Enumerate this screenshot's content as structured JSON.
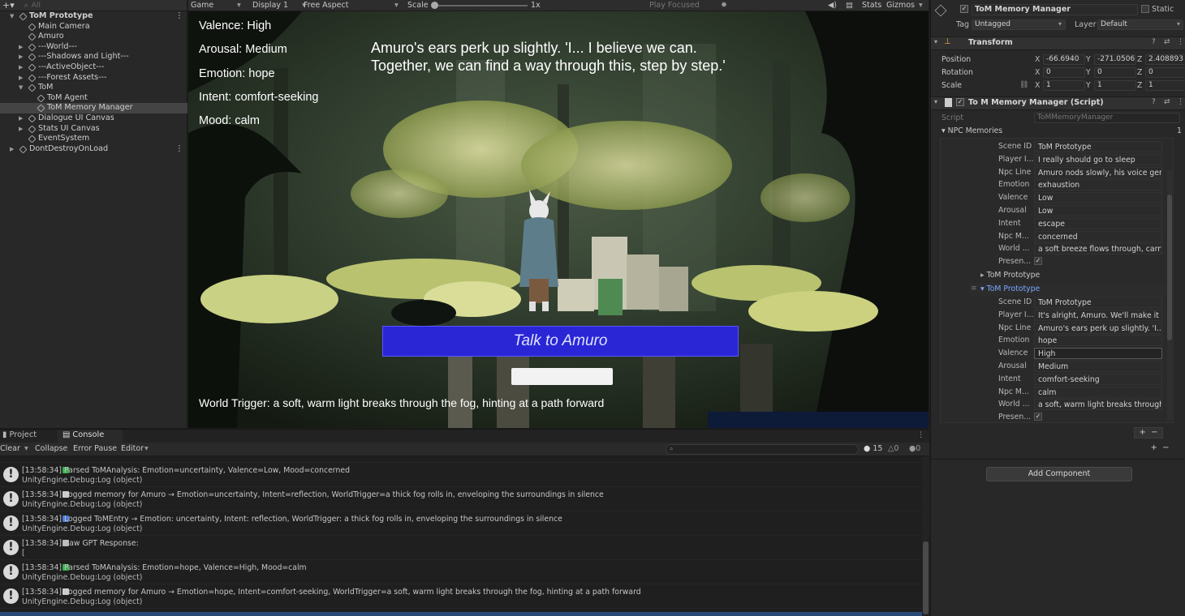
{
  "hierarchy": {
    "search": "All",
    "items": [
      {
        "label": "ToM Prototype",
        "bold": true
      },
      {
        "label": "Main Camera"
      },
      {
        "label": "Amuro"
      },
      {
        "label": "---World---"
      },
      {
        "label": "---Shadows and Light---"
      },
      {
        "label": "---ActiveObject---"
      },
      {
        "label": "---Forest Assets---"
      },
      {
        "label": "ToM"
      },
      {
        "label": "ToM Agent"
      },
      {
        "label": "ToM Memory Manager",
        "selected": true
      },
      {
        "label": "Dialogue UI Canvas"
      },
      {
        "label": "Stats UI Canvas"
      },
      {
        "label": "EventSystem"
      },
      {
        "label": "DontDestroyOnLoad"
      }
    ]
  },
  "game_toolbar": {
    "tab": "Game",
    "display": "Display 1",
    "aspect": "Free Aspect",
    "scale_label": "Scale",
    "scale_value": "1x",
    "play": "Play Focused",
    "stats": "Stats",
    "gizmos": "Gizmos"
  },
  "game": {
    "valence": "Valence: High",
    "arousal": "Arousal: Medium",
    "emotion": "Emotion: hope",
    "intent": "Intent: comfort-seeking",
    "mood": "Mood: calm",
    "speech": "Amuro's ears perk up slightly. 'I... I believe we can. Together, we can find a way through this, step by step.'",
    "talk_button": "Talk to Amuro",
    "world_trigger": "World Trigger: a soft, warm light breaks through the fog, hinting at a path forward"
  },
  "inspector": {
    "object_name": "ToM Memory Manager",
    "static": "Static",
    "tag_label": "Tag",
    "tag": "Untagged",
    "layer_label": "Layer",
    "layer": "Default",
    "transform": "Transform",
    "position_label": "Position",
    "position": [
      "-66.6940",
      "-271.0506",
      "2.408893"
    ],
    "rotation_label": "Rotation",
    "rotation": [
      "0",
      "0",
      "0"
    ],
    "scale_label": "Scale",
    "scale": [
      "1",
      "1",
      "1"
    ],
    "script_component": "To M Memory Manager (Script)",
    "script_label": "Script",
    "script_value": "ToMMemoryManager",
    "npc_memories": "NPC Memories",
    "npc_count": "1",
    "labels": [
      "Scene ID",
      "Player I...",
      "Npc Line",
      "Emotion",
      "Valence",
      "Arousal",
      "Intent",
      "Npc M...",
      "World ...",
      "Presen..."
    ],
    "memory_a": [
      "ToM Prototype",
      "I really should go to sleep",
      "Amuro nods slowly, his voice gent",
      "exhaustion",
      "Low",
      "Low",
      "escape",
      "concerned",
      "a soft breeze flows through, carry"
    ],
    "element_collapsed": "ToM Prototype",
    "element_expanded": "ToM Prototype",
    "memory_b": [
      "ToM Prototype",
      "It's alright, Amuro. We'll make it th",
      "Amuro's ears perk up slightly. 'I... I",
      "hope",
      "High",
      "Medium",
      "comfort-seeking",
      "calm",
      "a soft, warm light breaks through t"
    ],
    "add_component": "Add Component"
  },
  "console": {
    "tab_project": "Project",
    "tab_console": "Console",
    "clear": "Clear",
    "collapse": "Collapse",
    "error_pause": "Error Pause",
    "editor": "Editor",
    "count_log": "15",
    "count_warn": "0",
    "count_err": "0",
    "entries": [
      {
        "l1": "[13:58:34]  Parsed ToMAnalysis: Emotion=uncertainty, Valence=Low, Mood=concerned",
        "l2": "UnityEngine.Debug:Log (object)",
        "badge": "#37b24d"
      },
      {
        "l1": "[13:58:34]  Logged memory for Amuro → Emotion=uncertainty, Intent=reflection, WorldTrigger=a thick fog rolls in, enveloping the surroundings in silence",
        "l2": "UnityEngine.Debug:Log (object)",
        "badge": "#cfcfcf"
      },
      {
        "l1": "[13:58:34]  Logged ToMEntry → Emotion: uncertainty, Intent: reflection, WorldTrigger: a thick fog rolls in, enveloping the surroundings in silence",
        "l2": "UnityEngine.Debug:Log (object)",
        "badge": "#4a7ad8"
      },
      {
        "l1": "[13:58:34]  Raw GPT Response:",
        "l2": "[",
        "badge": "#bbbbbb"
      },
      {
        "l1": "[13:58:34]  Parsed ToMAnalysis: Emotion=hope, Valence=High, Mood=calm",
        "l2": "UnityEngine.Debug:Log (object)",
        "badge": "#37b24d"
      },
      {
        "l1": "[13:58:34]  Logged memory for Amuro → Emotion=hope, Intent=comfort-seeking, WorldTrigger=a soft, warm light breaks through the fog, hinting at a path forward",
        "l2": "UnityEngine.Debug:Log (object)",
        "badge": "#cfcfcf"
      }
    ]
  }
}
